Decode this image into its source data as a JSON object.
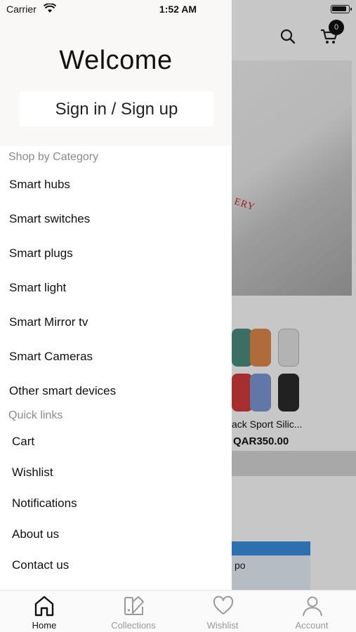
{
  "status_bar": {
    "carrier": "Carrier",
    "time": "1:52 AM"
  },
  "drawer": {
    "welcome": "Welcome",
    "sign_in": "Sign in / Sign up",
    "categories_title": "Shop by Category",
    "categories": [
      "Smart hubs",
      "Smart switches",
      "Smart plugs",
      "Smart light",
      "Smart Mirror tv",
      "Smart Cameras",
      "Other smart devices"
    ],
    "quick_links_title": "Quick links",
    "quick_links": [
      "Cart",
      "Wishlist",
      "Notifications",
      "About us",
      "Contact us"
    ]
  },
  "background": {
    "cart_count": "0",
    "banner_text": "ERY",
    "product_name": "ack Sport Silic...",
    "product_price": "QAR350.00",
    "box_label": "po"
  },
  "tab_bar": {
    "tabs": [
      {
        "label": "Home",
        "icon": "home-icon",
        "active": true
      },
      {
        "label": "Collections",
        "icon": "collections-icon",
        "active": false
      },
      {
        "label": "Wishlist",
        "icon": "heart-icon",
        "active": false
      },
      {
        "label": "Account",
        "icon": "account-icon",
        "active": false
      }
    ]
  },
  "colors": {
    "accent": "#111111",
    "inactive": "#999999",
    "drawer_header_bg": "#faf8f6",
    "section_title": "#8a8a8a"
  }
}
